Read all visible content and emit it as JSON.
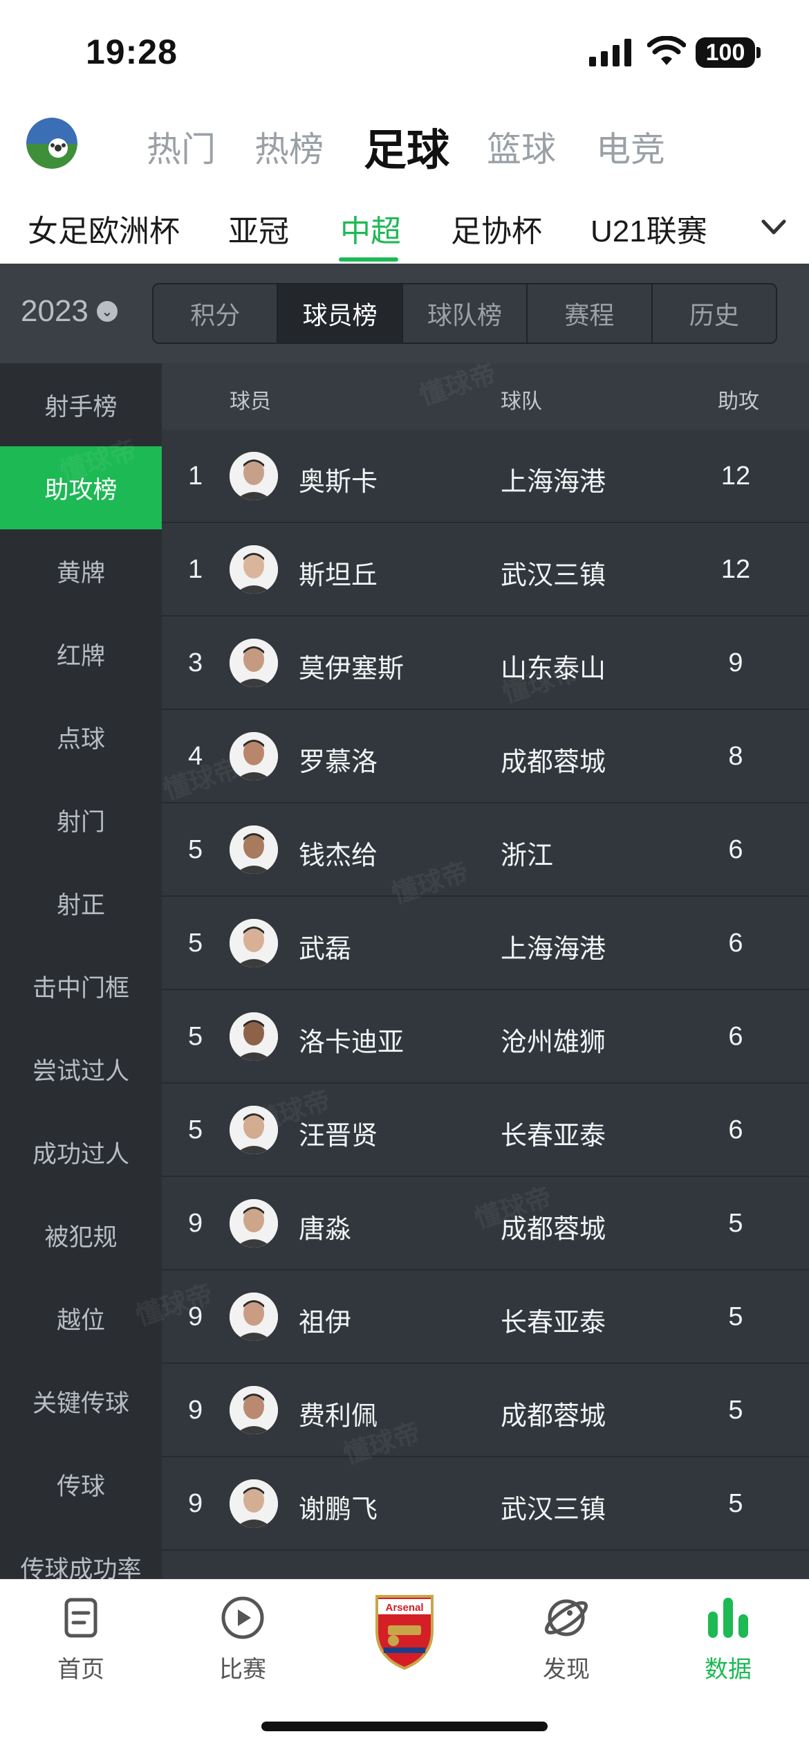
{
  "status_bar": {
    "time": "19:28",
    "battery": "100"
  },
  "sport_tabs": [
    {
      "label": "热门"
    },
    {
      "label": "热榜"
    },
    {
      "label": "足球"
    },
    {
      "label": "篮球"
    },
    {
      "label": "电竞"
    }
  ],
  "active_sport": "足球",
  "league_tabs": [
    {
      "label": "女足欧洲杯"
    },
    {
      "label": "亚冠"
    },
    {
      "label": "中超"
    },
    {
      "label": "足协杯"
    },
    {
      "label": "U21联赛"
    }
  ],
  "active_league": "中超",
  "season": "2023",
  "segments": [
    {
      "label": "积分"
    },
    {
      "label": "球员榜"
    },
    {
      "label": "球队榜"
    },
    {
      "label": "赛程"
    },
    {
      "label": "历史"
    }
  ],
  "active_segment": "球员榜",
  "categories": [
    "射手榜",
    "助攻榜",
    "黄牌",
    "红牌",
    "点球",
    "射门",
    "射正",
    "击中门框",
    "尝试过人",
    "成功过人",
    "被犯规",
    "越位",
    "关键传球",
    "传球",
    "传球成功率"
  ],
  "active_category": "助攻榜",
  "table": {
    "headers": {
      "player": "球员",
      "team": "球队",
      "stat": "助攻"
    },
    "rows": [
      {
        "rank": "1",
        "name": "奥斯卡",
        "team": "上海海港",
        "value": "12"
      },
      {
        "rank": "1",
        "name": "斯坦丘",
        "team": "武汉三镇",
        "value": "12"
      },
      {
        "rank": "3",
        "name": "莫伊塞斯",
        "team": "山东泰山",
        "value": "9"
      },
      {
        "rank": "4",
        "name": "罗慕洛",
        "team": "成都蓉城",
        "value": "8"
      },
      {
        "rank": "5",
        "name": "钱杰给",
        "team": "浙江",
        "value": "6"
      },
      {
        "rank": "5",
        "name": "武磊",
        "team": "上海海港",
        "value": "6"
      },
      {
        "rank": "5",
        "name": "洛卡迪亚",
        "team": "沧州雄狮",
        "value": "6"
      },
      {
        "rank": "5",
        "name": "汪晋贤",
        "team": "长春亚泰",
        "value": "6"
      },
      {
        "rank": "9",
        "name": "唐淼",
        "team": "成都蓉城",
        "value": "5"
      },
      {
        "rank": "9",
        "name": "祖伊",
        "team": "长春亚泰",
        "value": "5"
      },
      {
        "rank": "9",
        "name": "费利佩",
        "team": "成都蓉城",
        "value": "5"
      },
      {
        "rank": "9",
        "name": "谢鹏飞",
        "team": "武汉三镇",
        "value": "5"
      }
    ]
  },
  "watermark_text": "懂球帝",
  "bottom_nav": [
    {
      "label": "首页",
      "icon": "document-icon"
    },
    {
      "label": "比赛",
      "icon": "play-icon"
    },
    {
      "label": "",
      "icon": "arsenal-crest-icon",
      "crest_text": "Arsenal"
    },
    {
      "label": "发现",
      "icon": "planet-icon"
    },
    {
      "label": "数据",
      "icon": "bar-chart-icon"
    }
  ],
  "active_nav": "数据",
  "colors": {
    "accent": "#1db954",
    "dark_bg": "#2e3338",
    "sidebar_bg": "#2a2e33"
  }
}
